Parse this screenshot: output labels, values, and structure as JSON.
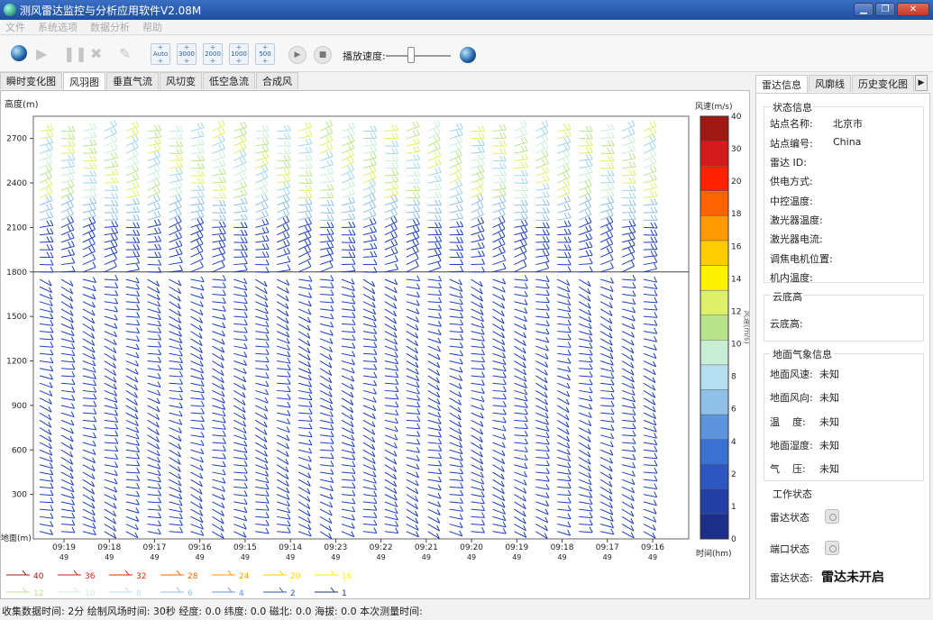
{
  "window": {
    "title": "测风雷达监控与分析应用软件V2.08M"
  },
  "menu": [
    "文件",
    "系统选项",
    "数据分析",
    "帮助"
  ],
  "toolbar": {
    "speed_buttons": [
      "Auto",
      "3000",
      "2000",
      "1000",
      "500"
    ],
    "playback_label": "播放速度:"
  },
  "tabs": [
    "瞬时变化图",
    "风羽图",
    "垂直气流",
    "风切变",
    "低空急流",
    "合成风"
  ],
  "active_tab": 1,
  "right_tabs": [
    "雷达信息",
    "风廓线",
    "历史变化图"
  ],
  "right_tab_arrow": "▶",
  "radar_info": {
    "status_title": "状态信息",
    "rows": [
      {
        "label": "站点名称:",
        "value": "北京市"
      },
      {
        "label": "站点编号:",
        "value": "China"
      },
      {
        "label": "雷达 ID:",
        "value": ""
      },
      {
        "label": "供电方式:",
        "value": ""
      },
      {
        "label": "中控温度:",
        "value": ""
      },
      {
        "label": "激光器温度:",
        "value": ""
      },
      {
        "label": "激光器电流:",
        "value": ""
      },
      {
        "label": "调焦电机位置:",
        "value": ""
      },
      {
        "label": "机内温度:",
        "value": ""
      }
    ],
    "cloud_title": "云底高",
    "cloud_label": "云底高:",
    "ground_title": "地面气象信息",
    "ground_rows": [
      {
        "label": "地面风速:",
        "value": "未知"
      },
      {
        "label": "地面风向:",
        "value": "未知"
      },
      {
        "label": "温    度:",
        "value": "未知"
      },
      {
        "label": "地面湿度:",
        "value": "未知"
      },
      {
        "label": "气    压:",
        "value": "未知"
      }
    ],
    "work_title": "工作状态",
    "radar_status_label": "雷达状态",
    "port_status_label": "端口状态",
    "radar_state_label": "雷达状态:",
    "radar_state_value": "雷达未开启"
  },
  "statusbar": "收集数据时间: 2分 绘制风场时间: 30秒 经度: 0.0 纬度: 0.0 磁北: 0.0 海拔: 0.0 本次测量时间:",
  "colors": {
    "titlebar": "#2a5db0",
    "barb_blue": "#1d3fbf"
  },
  "chart_data": {
    "type": "wind-barb",
    "ylabel": "高度(m)",
    "ground_label": "地面(m)",
    "yticks": [
      300,
      600,
      900,
      1200,
      1500,
      1800,
      2100,
      2400,
      2700
    ],
    "ylim": [
      0,
      2850
    ],
    "xticks": [
      {
        "time": "09:19",
        "sub": "49"
      },
      {
        "time": "09:18",
        "sub": "49"
      },
      {
        "time": "09:17",
        "sub": "49"
      },
      {
        "time": "09:16",
        "sub": "49"
      },
      {
        "time": "09:15",
        "sub": "49"
      },
      {
        "time": "09:14",
        "sub": "49"
      },
      {
        "time": "09:23",
        "sub": "49"
      },
      {
        "time": "09:22",
        "sub": "49"
      },
      {
        "time": "09:21",
        "sub": "49"
      },
      {
        "time": "09:20",
        "sub": "49"
      },
      {
        "time": "09:19",
        "sub": "49"
      },
      {
        "time": "09:18",
        "sub": "49"
      },
      {
        "time": "09:17",
        "sub": "49"
      },
      {
        "time": "09:16",
        "sub": "49"
      }
    ],
    "horizontal_line_m": 1800,
    "colorbar": {
      "title": "风速(m/s)",
      "side_label": "风速(m/s)",
      "bottom_label": "时间(hm)",
      "ticks": [
        0,
        1,
        2,
        4,
        6,
        8,
        10,
        12,
        14,
        16,
        18,
        20,
        30,
        40
      ],
      "colors": [
        "#1b2f8a",
        "#2240a6",
        "#2c56c0",
        "#3b72d2",
        "#5d95dc",
        "#8fc0e8",
        "#b6e0ef",
        "#c8eed6",
        "#b9e48b",
        "#dcf06a",
        "#fff200",
        "#ffcc00",
        "#ff9a00",
        "#ff6400",
        "#ff2200",
        "#d41a1a",
        "#a01812"
      ]
    },
    "legend": [
      {
        "label": "40",
        "color": "#a01812"
      },
      {
        "label": "36",
        "color": "#d41a1a"
      },
      {
        "label": "32",
        "color": "#ff2200"
      },
      {
        "label": "28",
        "color": "#ff6400"
      },
      {
        "label": "24",
        "color": "#ff9a00"
      },
      {
        "label": "20",
        "color": "#ffcc00"
      },
      {
        "label": "16",
        "color": "#fff200"
      },
      {
        "label": "12",
        "color": "#b9e48b"
      },
      {
        "label": "10",
        "color": "#c8eed6"
      },
      {
        "label": "8",
        "color": "#b6e0ef"
      },
      {
        "label": "6",
        "color": "#8fc0e8"
      },
      {
        "label": "4",
        "color": "#5d95dc"
      },
      {
        "label": "2",
        "color": "#2c56c0"
      },
      {
        "label": "1",
        "color": "#1b2f8a"
      }
    ]
  }
}
